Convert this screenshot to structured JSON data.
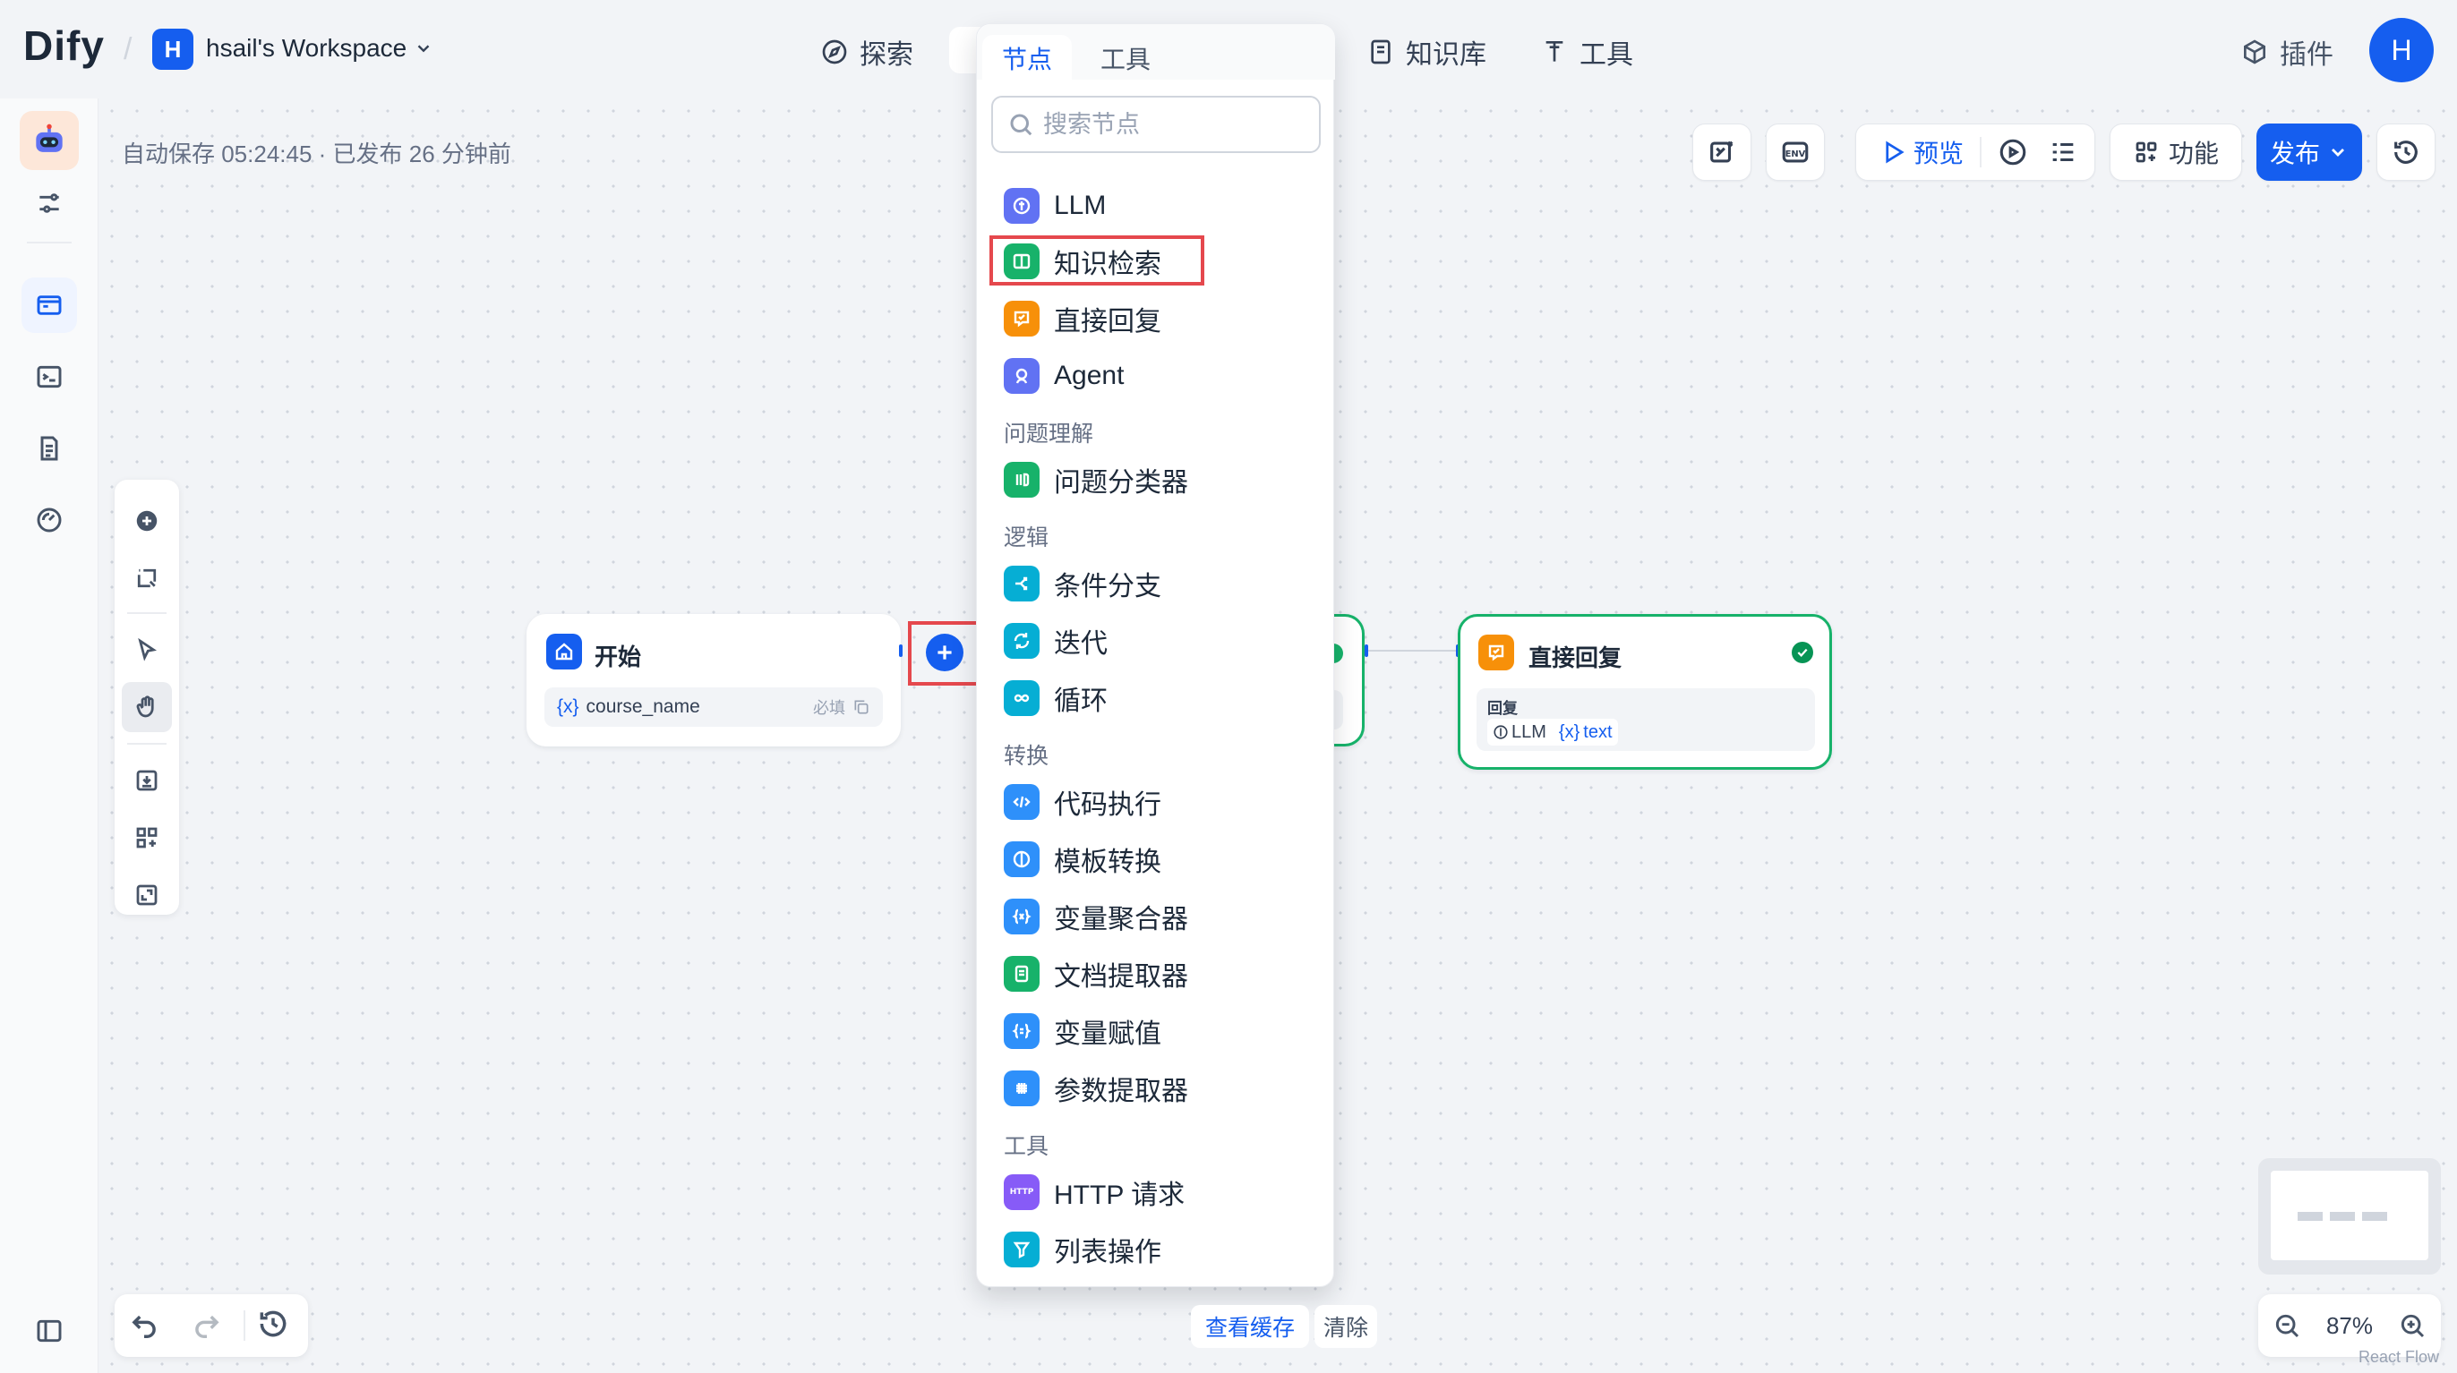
{
  "app": {
    "logo": "Dify",
    "workspace_initial": "H",
    "workspace_name": "hsail's Workspace",
    "user_initial": "H"
  },
  "nav": {
    "explore": "探索",
    "knowledge": "知识库",
    "tools": "工具",
    "plugins": "插件"
  },
  "status": {
    "autosave": "自动保存 05:24:45 · 已发布 26 分钟前"
  },
  "toolbar": {
    "preview": "预览",
    "features": "功能",
    "publish": "发布"
  },
  "nodes": {
    "start": {
      "title": "开始",
      "var_icon": "{x}",
      "var_name": "course_name",
      "required": "必填"
    },
    "answer": {
      "title": "直接回复",
      "section": "回复",
      "ref_source": "LLM",
      "ref_var_icon": "{x}",
      "ref_var": "text"
    }
  },
  "menu": {
    "tabs": [
      "节点",
      "工具"
    ],
    "active_tab": "节点",
    "search_placeholder": "搜索节点",
    "groups": {
      "basic": [
        "LLM",
        "知识检索",
        "直接回复",
        "Agent"
      ],
      "question_header": "问题理解",
      "question": [
        "问题分类器"
      ],
      "logic_header": "逻辑",
      "logic": [
        "条件分支",
        "迭代",
        "循环"
      ],
      "transform_header": "转换",
      "transform": [
        "代码执行",
        "模板转换",
        "变量聚合器",
        "文档提取器",
        "变量赋值",
        "参数提取器"
      ],
      "tools_header": "工具",
      "tools": [
        "HTTP 请求",
        "列表操作"
      ]
    },
    "highlighted_item": "知识检索"
  },
  "bottom": {
    "view_cache": "查看缓存",
    "clear": "清除",
    "zoom": "87%",
    "attribution": "React Flow"
  },
  "colors": {
    "primary": "#155eef",
    "highlight_red": "#e5484d",
    "success_green": "#079455",
    "orange": "#f79009"
  }
}
